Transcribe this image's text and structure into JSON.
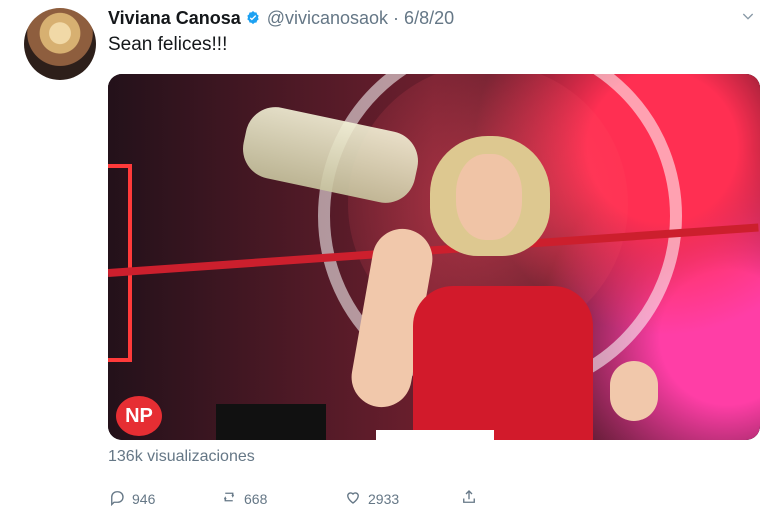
{
  "tweet": {
    "author_name": "Viviana Canosa",
    "handle_date": "@vivicanosaok · 6/8/20",
    "text": "Sean felices!!!",
    "views": "136k visualizaciones",
    "media_logo": "NP"
  },
  "actions": {
    "replies": "946",
    "retweets": "668",
    "likes": "2933"
  },
  "icons": {
    "verified": "verified-badge-icon",
    "reply": "reply-icon",
    "retweet": "retweet-icon",
    "like": "heart-icon",
    "share": "share-icon",
    "more": "chevron-down-icon"
  },
  "colors": {
    "text_primary": "#14171a",
    "text_secondary": "#657786",
    "verified": "#1da1f2"
  }
}
